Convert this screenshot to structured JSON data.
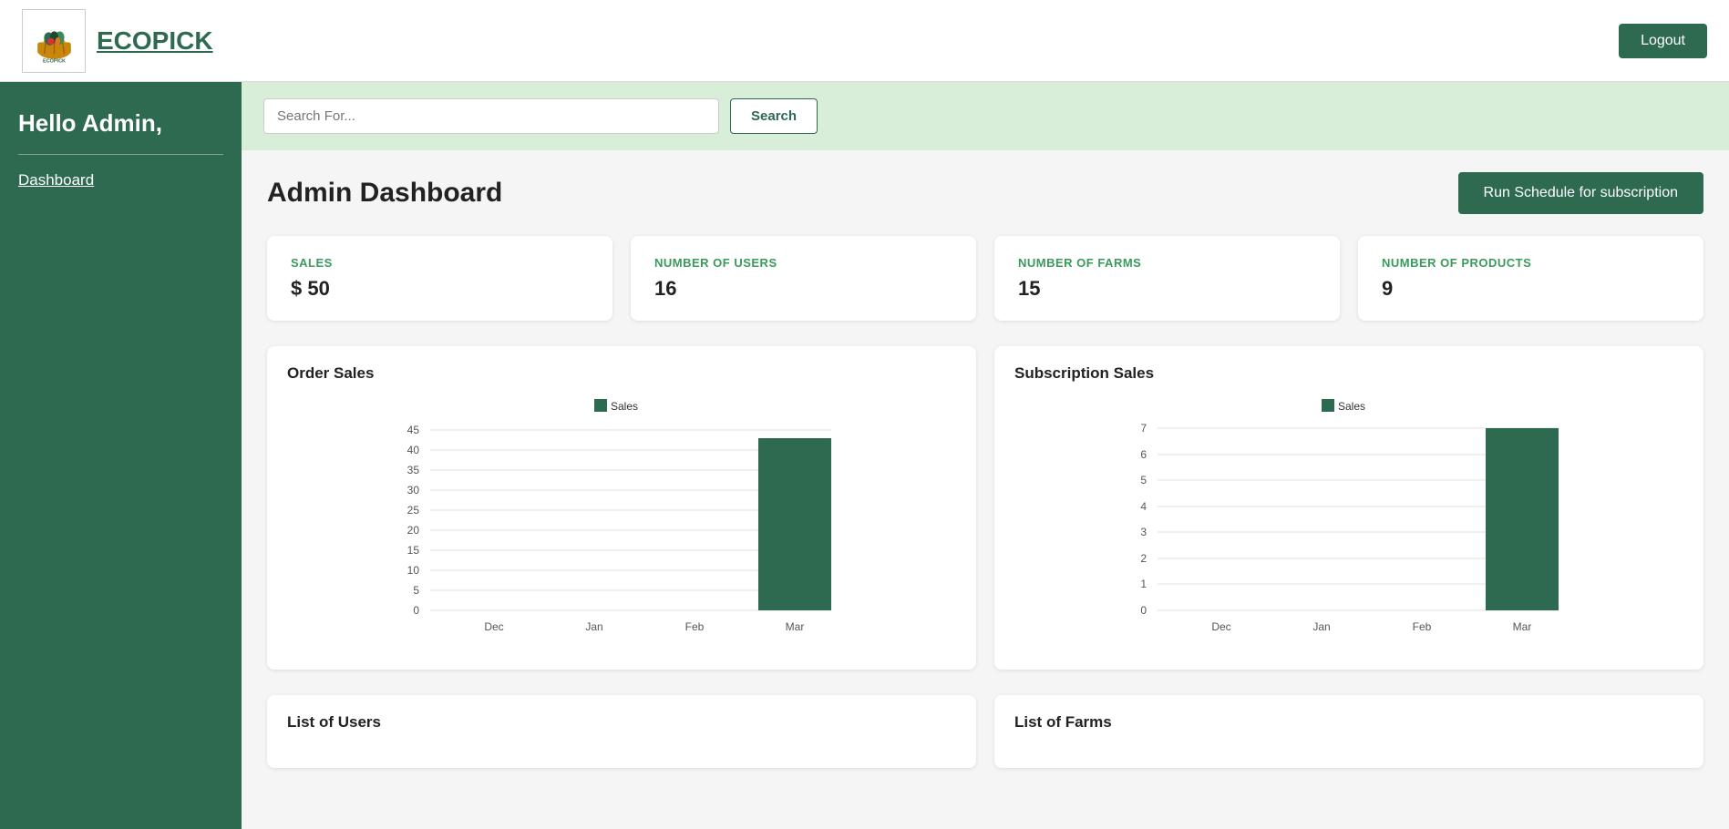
{
  "header": {
    "app_title": "ECOPICK",
    "logout_label": "Logout"
  },
  "sidebar": {
    "greeting": "Hello Admin,",
    "dashboard_link": "Dashboard"
  },
  "search": {
    "placeholder": "Search For...",
    "button_label": "Search"
  },
  "dashboard": {
    "title": "Admin Dashboard",
    "run_schedule_label": "Run Schedule for subscription",
    "stats": [
      {
        "label": "SALES",
        "value": "$ 50"
      },
      {
        "label": "NUMBER OF USERS",
        "value": "16"
      },
      {
        "label": "NUMBER OF FARMS",
        "value": "15"
      },
      {
        "label": "NUMBER OF PRODUCTS",
        "value": "9"
      }
    ],
    "order_chart": {
      "title": "Order Sales",
      "legend": "Sales",
      "months": [
        "Dec",
        "Jan",
        "Feb",
        "Mar"
      ],
      "values": [
        0,
        0,
        0,
        43
      ]
    },
    "subscription_chart": {
      "title": "Subscription Sales",
      "legend": "Sales",
      "months": [
        "Dec",
        "Jan",
        "Feb",
        "Mar"
      ],
      "values": [
        0,
        0,
        0,
        7
      ]
    },
    "list_users_title": "List of Users",
    "list_farms_title": "List of Farms"
  }
}
